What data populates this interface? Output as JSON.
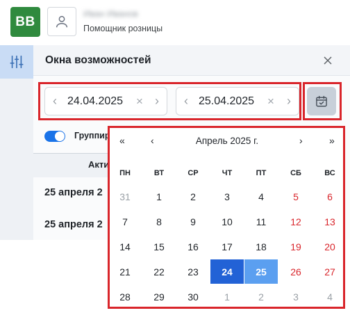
{
  "header": {
    "logo_text": "BB",
    "user_name": "Иван Иванов",
    "user_role": "Помощник розницы"
  },
  "panel": {
    "title": "Окна возможностей",
    "date_from": "24.04.2025",
    "date_to": "25.04.2025",
    "group_label": "Группир",
    "table_header": "Акти",
    "rows": [
      "25 апреля 2",
      "25 апреля 2"
    ]
  },
  "calendar": {
    "month_label": "Апрель 2025 г.",
    "nav": {
      "prev_year": "«",
      "prev_month": "‹",
      "next_month": "›",
      "next_year": "»"
    },
    "weekdays": [
      "ПН",
      "ВТ",
      "СР",
      "ЧТ",
      "ПТ",
      "СБ",
      "ВС"
    ],
    "weeks": [
      [
        "31",
        "1",
        "2",
        "3",
        "4",
        "5",
        "6"
      ],
      [
        "7",
        "8",
        "9",
        "10",
        "11",
        "12",
        "13"
      ],
      [
        "14",
        "15",
        "16",
        "17",
        "18",
        "19",
        "20"
      ],
      [
        "21",
        "22",
        "23",
        "24",
        "25",
        "26",
        "27"
      ],
      [
        "28",
        "29",
        "30",
        "1",
        "2",
        "3",
        "4"
      ]
    ],
    "selected_start": "24",
    "selected_end": "25"
  },
  "colors": {
    "brand_green": "#2f8a3e",
    "accent_blue": "#2262d6",
    "range_end_blue": "#5b9ff0",
    "weekend_red": "#d9252b",
    "highlight_border": "#d9252b"
  }
}
